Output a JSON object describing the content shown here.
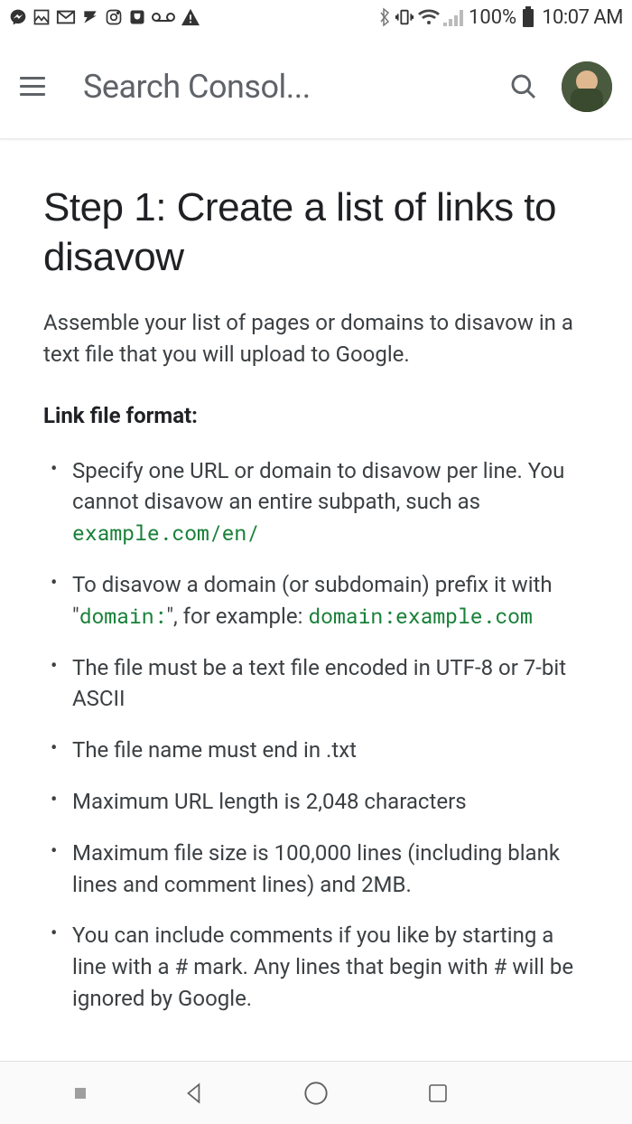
{
  "status_bar": {
    "battery_text": "100%",
    "time": "10:07 AM"
  },
  "app_bar": {
    "title": "Search Consol..."
  },
  "content": {
    "heading": "Step 1: Create a list of links to disavow",
    "intro": "Assemble your list of pages or domains to disavow in a text file that you will upload to Google.",
    "subhead": "Link file format:",
    "rules": [
      {
        "pre": "Specify one URL or domain to disavow per line. You cannot disavow an entire subpath, such as ",
        "code": "example.com/en/",
        "post": ""
      },
      {
        "pre": "To disavow a domain (or subdomain) prefix it with \"",
        "code": "domain:",
        "mid": "\", for example: ",
        "code2": "domain:example.com",
        "post": ""
      },
      {
        "pre": "The file must be a text file encoded in UTF-8 or 7-bit ASCII"
      },
      {
        "pre": "The file name must end in .txt"
      },
      {
        "pre": "Maximum URL length is 2,048 characters"
      },
      {
        "pre": "Maximum file size is 100,000 lines (including blank lines and comment lines) and 2MB."
      },
      {
        "pre": "You can include comments if you like by starting a line with a # mark. Any lines that begin with # will be ignored by Google."
      }
    ]
  }
}
